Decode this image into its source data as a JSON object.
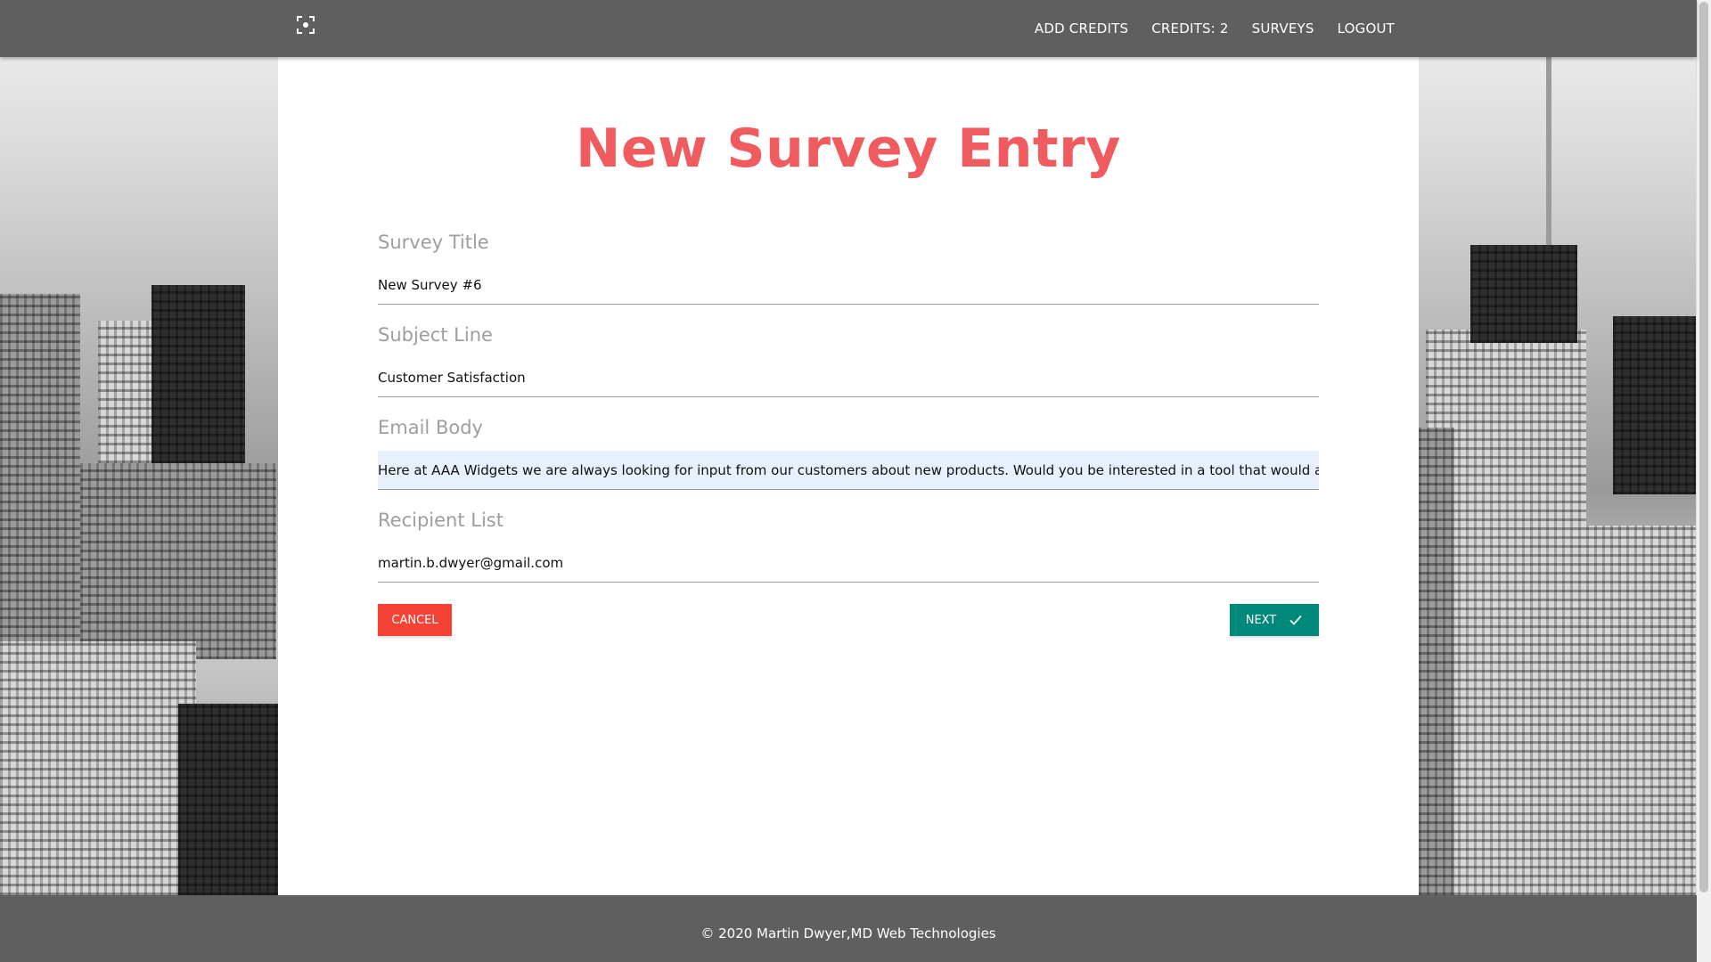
{
  "navbar": {
    "brand_icon": "focus-frame-icon",
    "links": [
      {
        "label": "ADD CREDITS"
      },
      {
        "label": "CREDITS: 2"
      },
      {
        "label": "SURVEYS"
      },
      {
        "label": "LOGOUT"
      }
    ]
  },
  "page": {
    "title": "New Survey Entry"
  },
  "form": {
    "fields": [
      {
        "label": "Survey Title",
        "value": "New Survey #6"
      },
      {
        "label": "Subject Line",
        "value": "Customer Satisfaction"
      },
      {
        "label": "Email Body",
        "value": "Here at AAA Widgets we are always looking for input from our customers about new products.  Would you be interested in a tool that would allow ea"
      },
      {
        "label": "Recipient List",
        "value": "martin.b.dwyer@gmail.com"
      }
    ],
    "cancel_label": "CANCEL",
    "next_label": "NEXT"
  },
  "footer": {
    "text": "© 2020 Martin Dwyer,MD Web Technologies"
  },
  "colors": {
    "title": "#ef5b5f",
    "cancel": "#f44336",
    "next": "#00897b",
    "navbar": "#5f5f5f"
  }
}
